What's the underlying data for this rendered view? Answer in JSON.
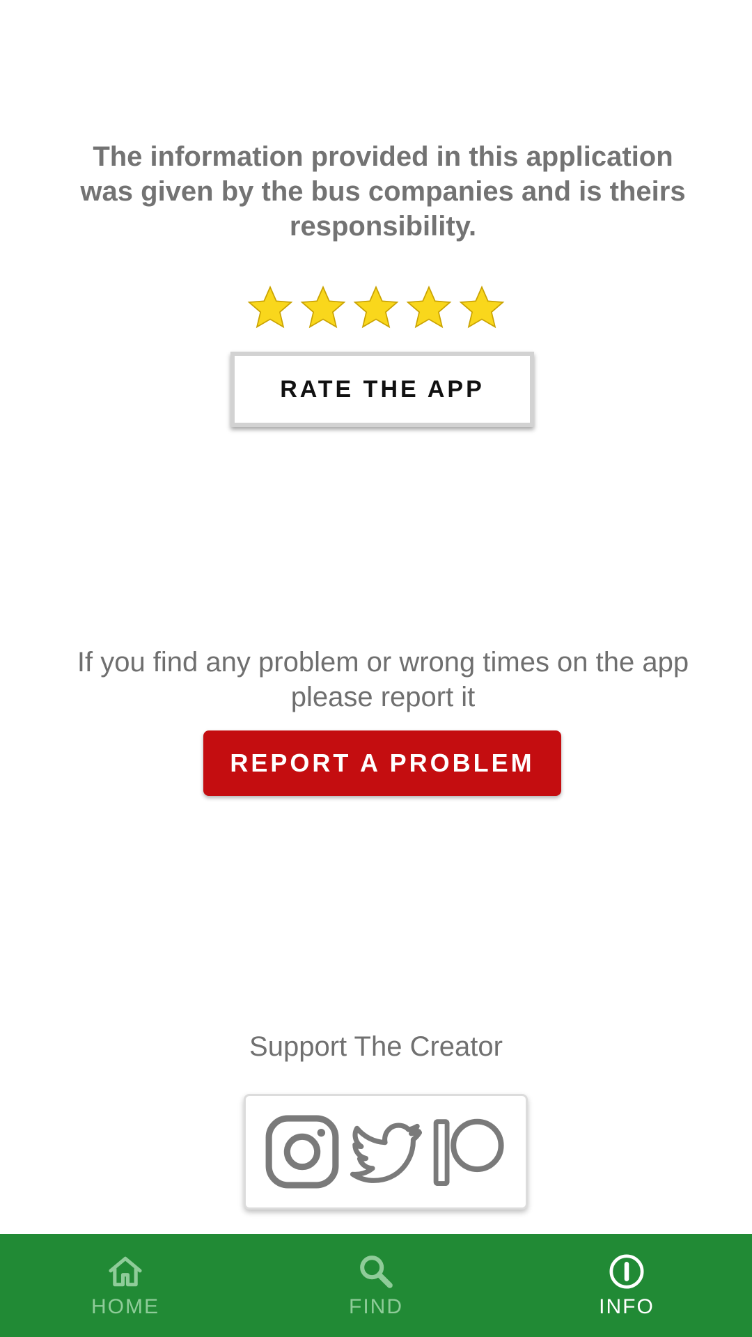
{
  "disclaimer": {
    "text": "The information provided in this application was given by the bus companies and is theirs responsibility."
  },
  "rating": {
    "stars_filled": 5,
    "stars_total": 5,
    "star_color": "#f9d71c"
  },
  "rate_button": {
    "label": "RATE THE APP"
  },
  "report": {
    "text": "If you find any problem or wrong times on the app please report it",
    "button_label": "REPORT A PROBLEM",
    "button_color": "#c40d10"
  },
  "support": {
    "title": "Support The Creator",
    "icons": [
      "instagram-icon",
      "twitter-icon",
      "patreon-icon"
    ]
  },
  "bottom_nav": {
    "background": "#218a35",
    "items": [
      {
        "label": "HOME",
        "icon": "home-icon",
        "active": false
      },
      {
        "label": "FIND",
        "icon": "search-icon",
        "active": false
      },
      {
        "label": "INFO",
        "icon": "info-icon",
        "active": true
      }
    ]
  }
}
